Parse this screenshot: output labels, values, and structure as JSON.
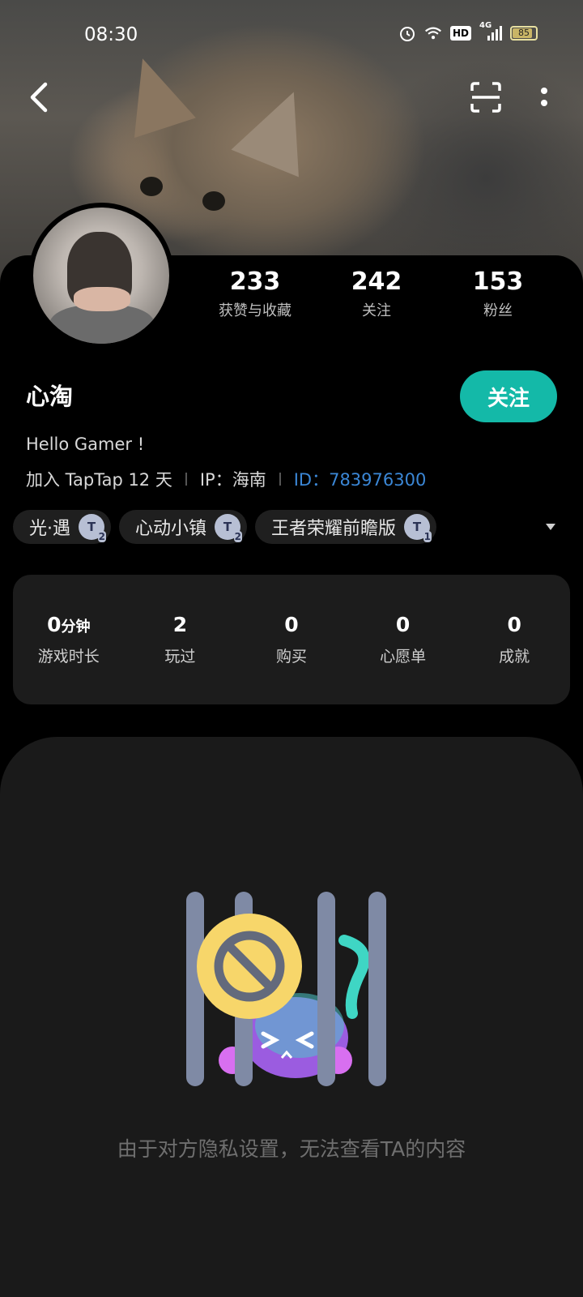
{
  "status_bar": {
    "time": "08:30",
    "network": "4G",
    "hd": "HD",
    "battery": "85",
    "battery_level": 0.85
  },
  "profile": {
    "name": "心淘",
    "bio": "Hello Gamer !",
    "joined": "加入 TapTap 12 天",
    "ip": "IP：海南",
    "id": "ID：783976300",
    "follow_label": "关注"
  },
  "stats": [
    {
      "value": "233",
      "label": "获赞与收藏"
    },
    {
      "value": "242",
      "label": "关注"
    },
    {
      "value": "153",
      "label": "粉丝"
    }
  ],
  "tags": [
    {
      "name": "光·遇",
      "level": "2"
    },
    {
      "name": "心动小镇",
      "level": "2"
    },
    {
      "name": "王者荣耀前瞻版",
      "level": "1"
    }
  ],
  "game_stats": [
    {
      "value": "0",
      "unit": "分钟",
      "label": "游戏时长"
    },
    {
      "value": "2",
      "unit": "",
      "label": "玩过"
    },
    {
      "value": "0",
      "unit": "",
      "label": "购买"
    },
    {
      "value": "0",
      "unit": "",
      "label": "心愿单"
    },
    {
      "value": "0",
      "unit": "",
      "label": "成就"
    }
  ],
  "privacy_message": "由于对方隐私设置，无法查看TA的内容",
  "colors": {
    "accent": "#14b9a8",
    "link": "#3b87d6"
  }
}
